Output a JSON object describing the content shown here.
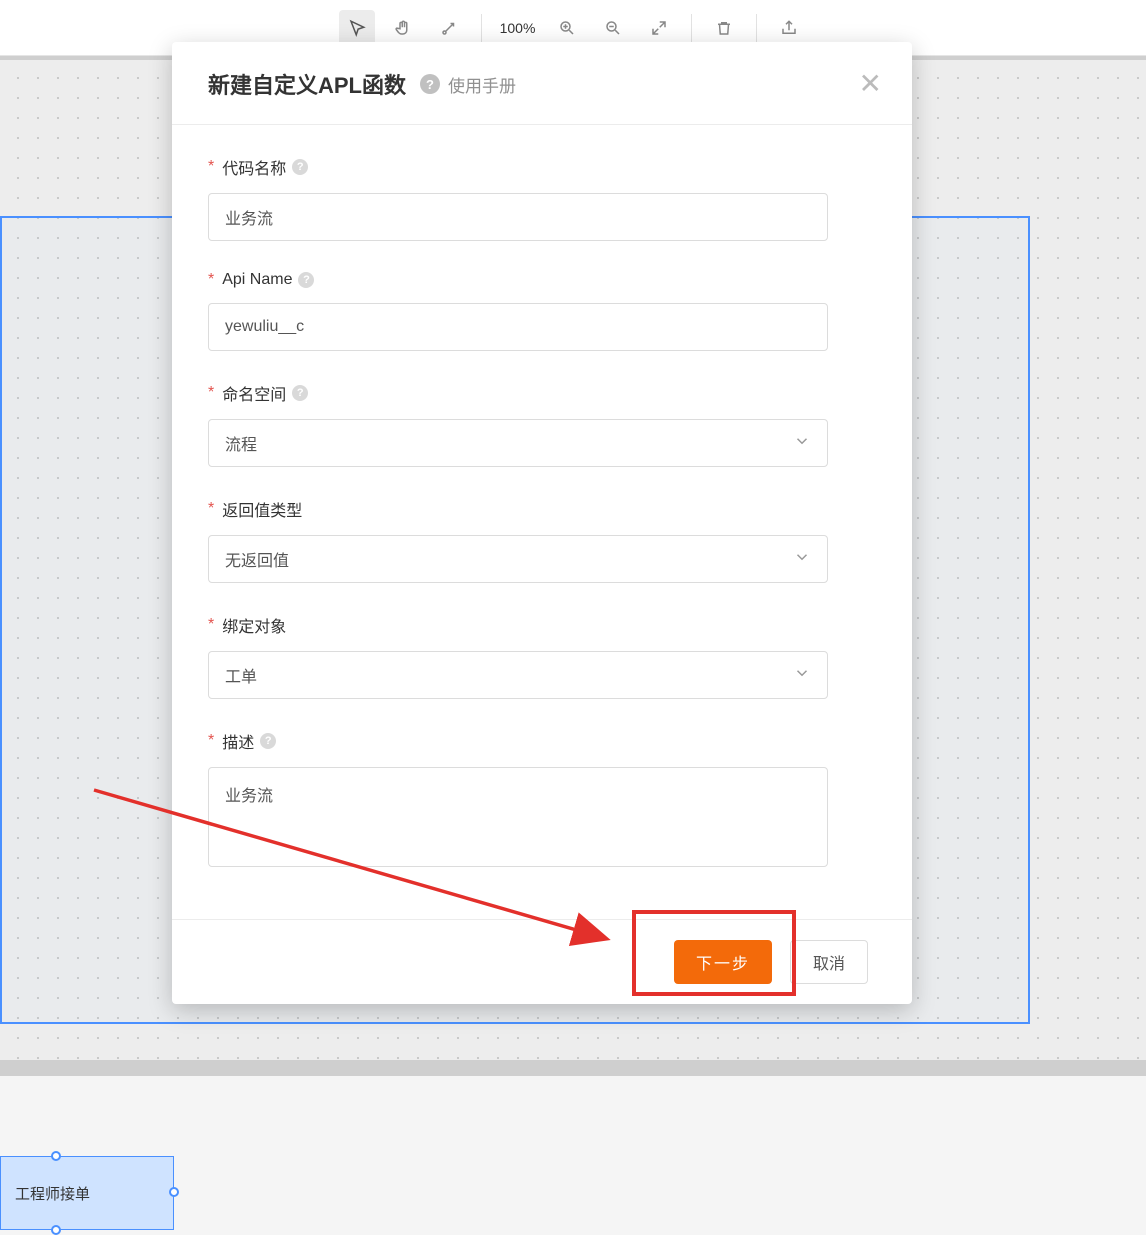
{
  "toolbar": {
    "zoom": "100%"
  },
  "canvas": {
    "node_label": "工程师接单"
  },
  "modal": {
    "title": "新建自定义APL函数",
    "manual_link": "使用手册",
    "fields": {
      "code_name": {
        "label": "代码名称",
        "value": "业务流"
      },
      "api_name": {
        "label": "Api Name",
        "value": "yewuliu__c"
      },
      "namespace": {
        "label": "命名空间",
        "value": "流程"
      },
      "return_type": {
        "label": "返回值类型",
        "value": "无返回值"
      },
      "bind_object": {
        "label": "绑定对象",
        "value": "工单"
      },
      "description": {
        "label": "描述",
        "value": "业务流"
      }
    },
    "buttons": {
      "next": "下一步",
      "cancel": "取消"
    }
  }
}
